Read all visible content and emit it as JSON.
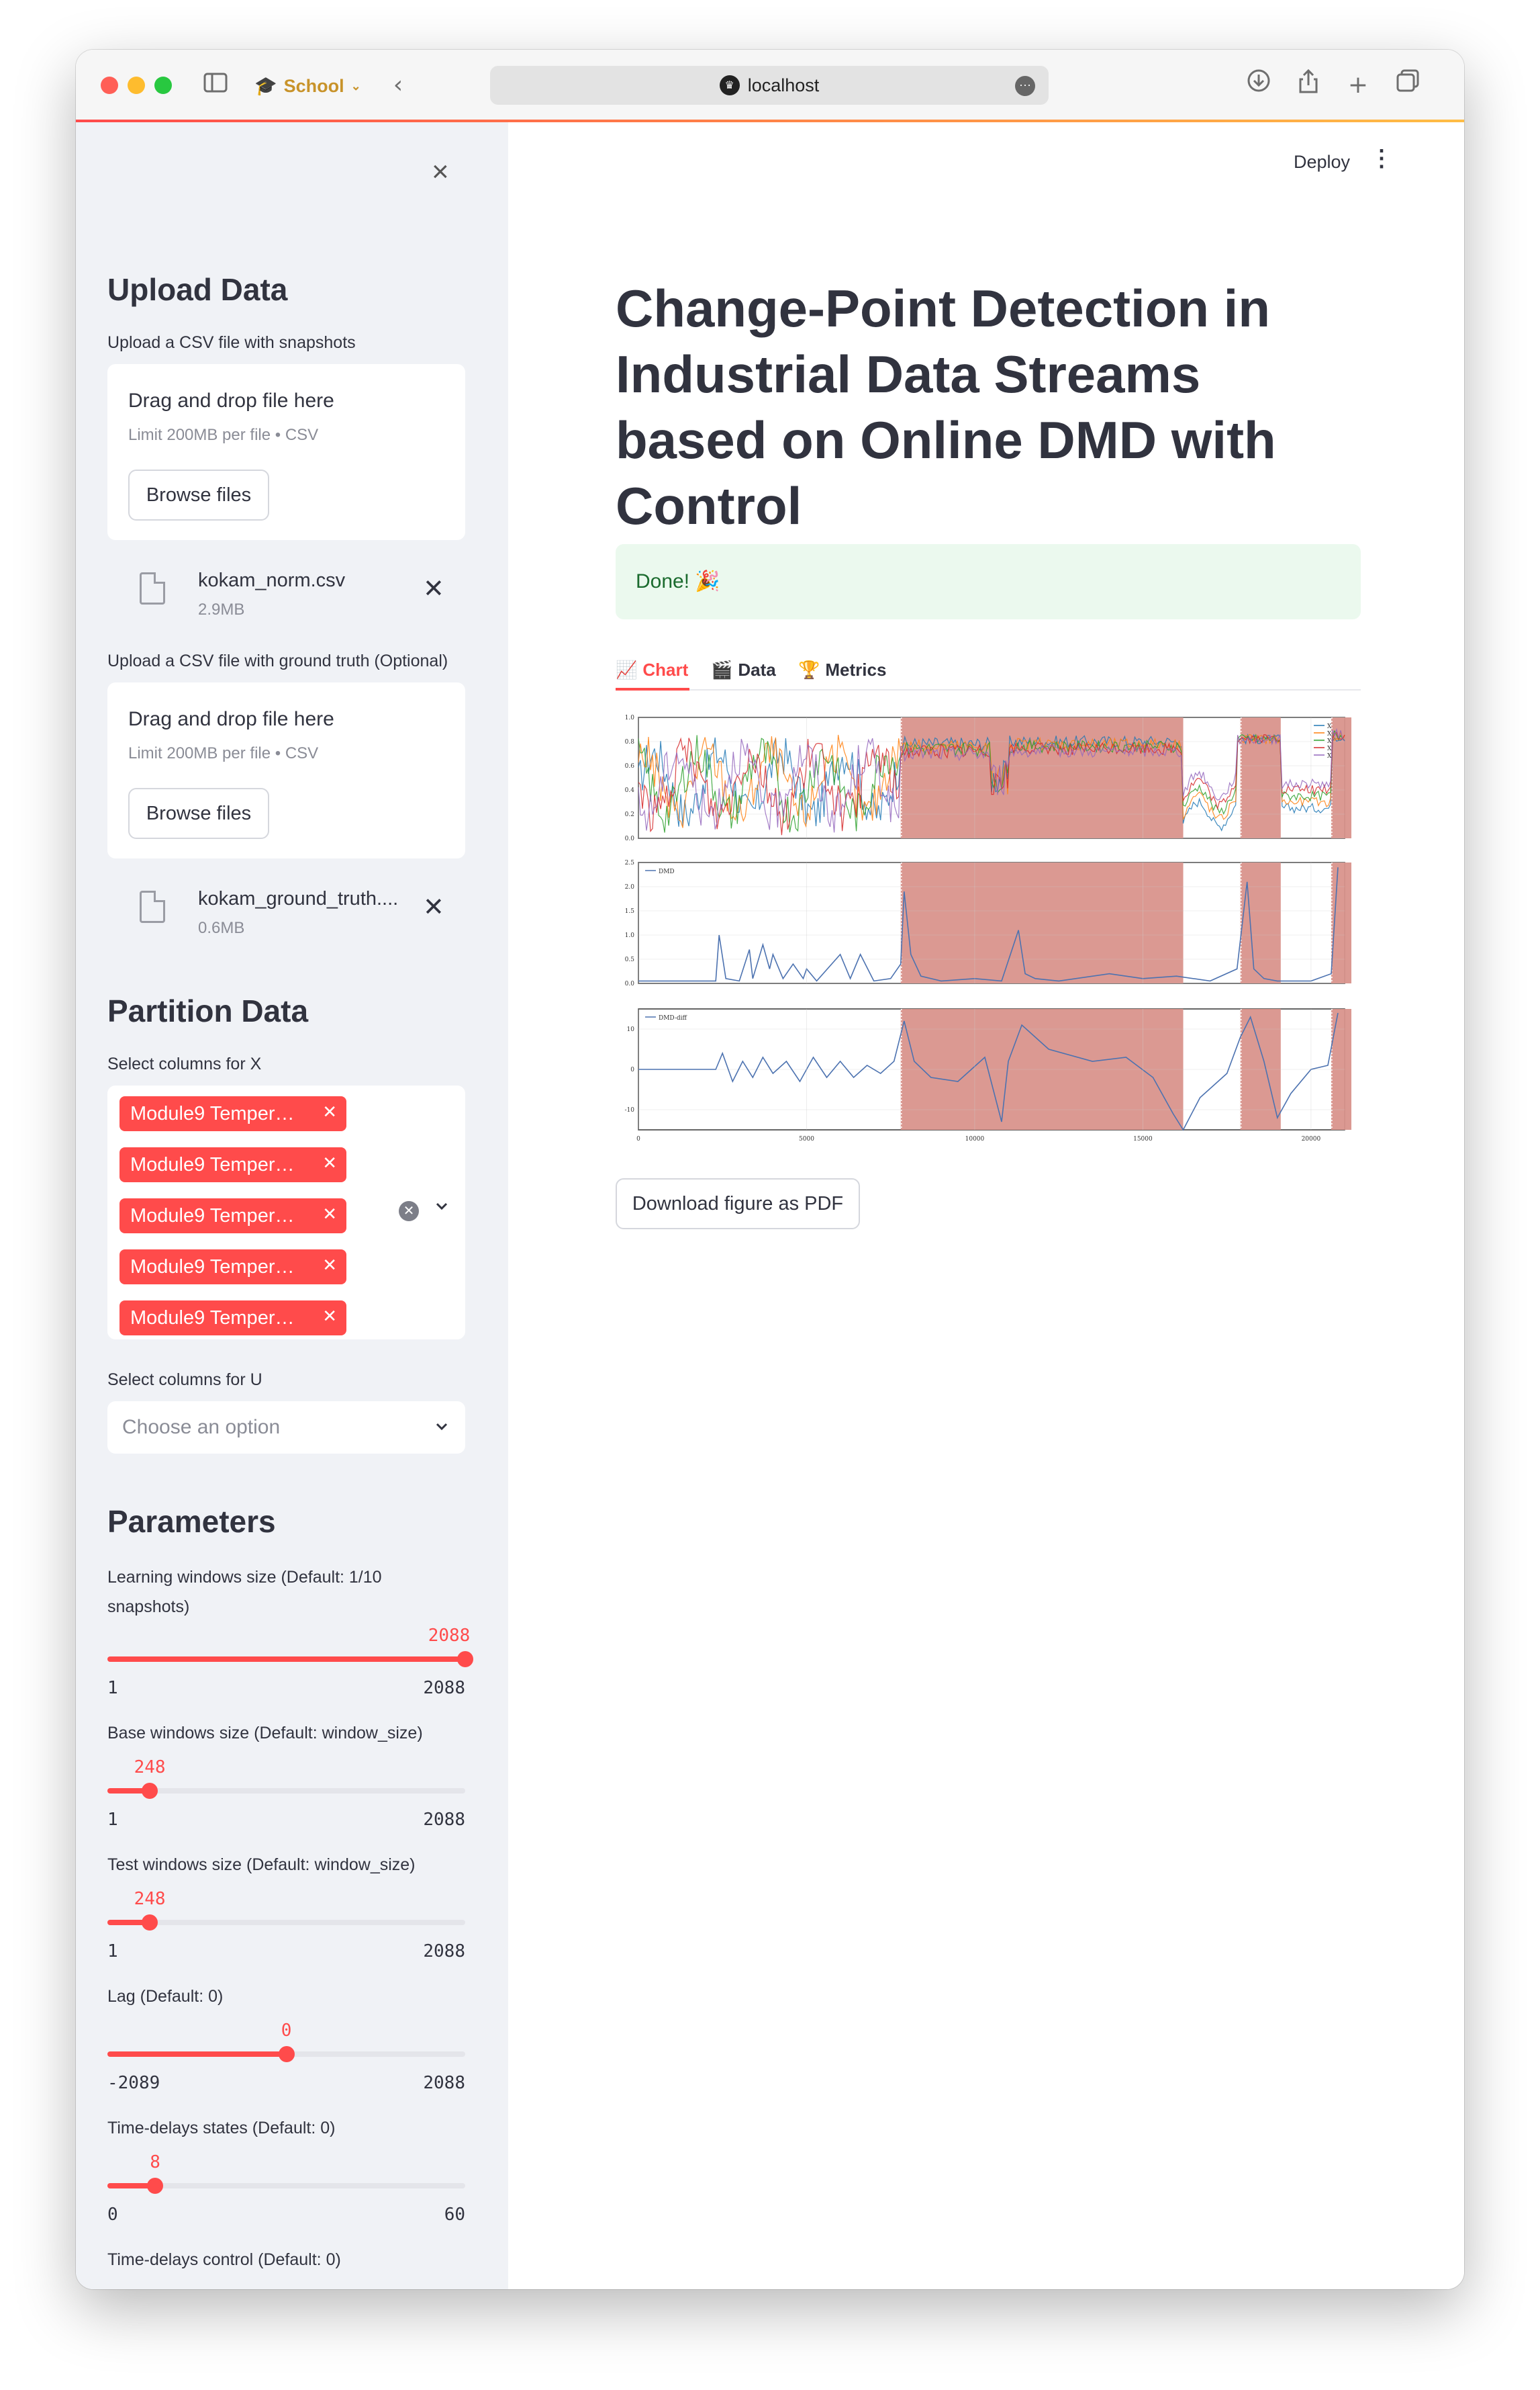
{
  "browser": {
    "profile": "School",
    "url": "localhost"
  },
  "sidebar": {
    "upload_title": "Upload Data",
    "snapshots": {
      "label": "Upload a CSV file with snapshots",
      "drop_title": "Drag and drop file here",
      "drop_limit": "Limit 200MB per file • CSV",
      "browse": "Browse files",
      "file_name": "kokam_norm.csv",
      "file_size": "2.9MB"
    },
    "ground_truth": {
      "label": "Upload a CSV file with ground truth (Optional)",
      "drop_title": "Drag and drop file here",
      "drop_limit": "Limit 200MB per file • CSV",
      "browse": "Browse files",
      "file_name": "kokam_ground_truth....",
      "file_size": "0.6MB"
    },
    "partition_title": "Partition Data",
    "x_label": "Select columns for X",
    "x_tags": [
      "Module9 Temper…",
      "Module9 Temper…",
      "Module9 Temper…",
      "Module9 Temper…",
      "Module9 Temper…"
    ],
    "u_label": "Select columns for U",
    "u_placeholder": "Choose an option",
    "parameters_title": "Parameters",
    "sliders": [
      {
        "label": "Learning windows size (Default: 1/10 snapshots)",
        "value": 2088,
        "min": 1,
        "max": 2088,
        "value_text": "2088",
        "min_text": "1",
        "max_text": "2088"
      },
      {
        "label": "Base windows size (Default: window_size)",
        "value": 248,
        "min": 1,
        "max": 2088,
        "value_text": "248",
        "min_text": "1",
        "max_text": "2088"
      },
      {
        "label": "Test windows size (Default: window_size)",
        "value": 248,
        "min": 1,
        "max": 2088,
        "value_text": "248",
        "min_text": "1",
        "max_text": "2088"
      },
      {
        "label": "Lag (Default: 0)",
        "value": 0,
        "min": -2089,
        "max": 2088,
        "value_text": "0",
        "min_text": "-2089",
        "max_text": "2088"
      },
      {
        "label": "Time-delays states (Default: 0)",
        "value": 8,
        "min": 0,
        "max": 60,
        "value_text": "8",
        "min_text": "0",
        "max_text": "60"
      }
    ],
    "last_label": "Time-delays control (Default: 0)"
  },
  "main": {
    "deploy": "Deploy",
    "title": "Change-Point Detection in Industrial Data Streams based on Online DMD with Control",
    "alert": "Done! 🎉",
    "tabs": [
      {
        "icon": "📈",
        "label": "Chart"
      },
      {
        "icon": "🎬",
        "label": "Data"
      },
      {
        "icon": "🏆",
        "label": "Metrics"
      }
    ],
    "download": "Download figure as PDF"
  },
  "chart_data": {
    "type": "line",
    "x_range": [
      0,
      21000
    ],
    "x_ticks": [
      "0",
      "5000",
      "10000",
      "15000",
      "20000"
    ],
    "change_regions": [
      [
        7800,
        16200
      ],
      [
        17900,
        19100
      ],
      [
        20600,
        21200
      ]
    ],
    "colors": {
      "highlight": "#d9938c",
      "accent": "#ff4b4b"
    },
    "panels": [
      {
        "legend": [
          "X",
          "X",
          "X",
          "X",
          "X"
        ],
        "ylim": [
          0,
          1.0
        ],
        "y_ticks": [
          "0.0",
          "0.2",
          "0.4",
          "0.6",
          "0.8",
          "1.0"
        ],
        "series_colors": [
          "#1f77b4",
          "#ff7f0e",
          "#2ca02c",
          "#d62728",
          "#9467bd"
        ]
      },
      {
        "legend": [
          "DMD"
        ],
        "ylim": [
          0,
          2.5
        ],
        "y_ticks": [
          "0.0",
          "0.5",
          "1.0",
          "1.5",
          "2.0",
          "2.5"
        ],
        "x": [
          0,
          2300,
          2400,
          2600,
          3000,
          3300,
          3400,
          3700,
          3900,
          4000,
          4300,
          4600,
          4900,
          5000,
          5300,
          6000,
          6300,
          6600,
          7000,
          7500,
          7800,
          7900,
          8100,
          8400,
          9000,
          10000,
          10800,
          11300,
          11500,
          11800,
          12500,
          14000,
          15000,
          16000,
          17000,
          17800,
          18100,
          18300,
          18600,
          19000,
          20000,
          20600,
          20800
        ],
        "y": [
          0.05,
          0.05,
          1.0,
          0.1,
          0.05,
          0.7,
          0.1,
          0.8,
          0.3,
          0.6,
          0.1,
          0.4,
          0.1,
          0.3,
          0.05,
          0.6,
          0.1,
          0.6,
          0.05,
          0.1,
          0.4,
          1.9,
          0.6,
          0.15,
          0.05,
          0.1,
          0.05,
          1.1,
          0.2,
          0.1,
          0.05,
          0.2,
          0.1,
          0.15,
          0.05,
          0.3,
          2.1,
          0.3,
          0.1,
          0.05,
          0.05,
          0.2,
          2.4
        ]
      },
      {
        "legend": [
          "DMD-diff"
        ],
        "ylim": [
          -15,
          15
        ],
        "y_ticks": [
          "10",
          "0",
          "-10"
        ],
        "x": [
          0,
          2300,
          2500,
          2800,
          3100,
          3400,
          3700,
          4000,
          4400,
          4800,
          5200,
          5600,
          6000,
          6400,
          6800,
          7200,
          7600,
          7900,
          8200,
          8700,
          9500,
          10300,
          10800,
          11000,
          11400,
          12200,
          13500,
          14500,
          15300,
          15900,
          16200,
          16700,
          17500,
          17900,
          18200,
          18600,
          19000,
          19400,
          20000,
          20500,
          20800
        ],
        "y": [
          0,
          0,
          4,
          -3,
          2,
          -2,
          3,
          -1,
          2,
          -3,
          3,
          -2,
          2,
          -2,
          1,
          -1,
          2,
          12,
          2,
          -2,
          -3,
          3,
          -13,
          2,
          11,
          5,
          2,
          3,
          -2,
          -11,
          -15,
          -7,
          -1,
          8,
          13,
          2,
          -12,
          -6,
          0,
          1,
          14
        ]
      }
    ]
  }
}
